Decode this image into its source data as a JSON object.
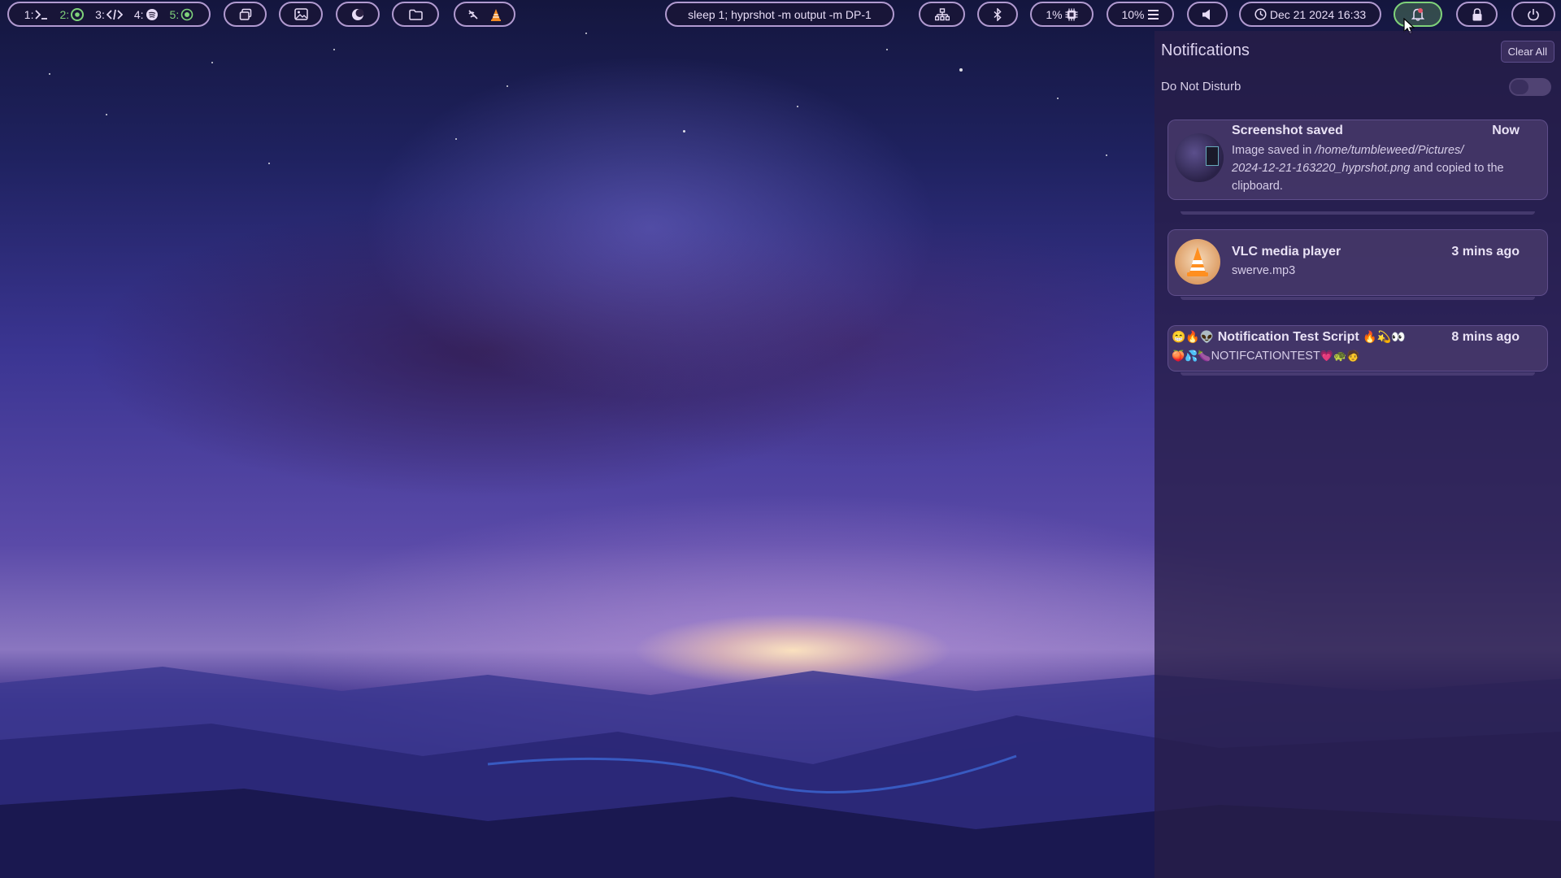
{
  "topbar": {
    "workspaces": [
      {
        "num": "1:",
        "icon": "terminal-icon",
        "active": false
      },
      {
        "num": "2:",
        "icon": "chrome-icon",
        "active": true
      },
      {
        "num": "3:",
        "icon": "code-icon",
        "active": false
      },
      {
        "num": "4:",
        "icon": "spotify-icon",
        "active": false
      },
      {
        "num": "5:",
        "icon": "record-icon",
        "active": true
      }
    ],
    "command": "sleep 1; hyprshot -m output -m DP-1",
    "cpu": "1%",
    "memory": "10%",
    "clock": "Dec 21 2024 16:33"
  },
  "notifications_panel": {
    "title": "Notifications",
    "clear_all": "Clear All",
    "dnd_label": "Do Not Disturb",
    "dnd_enabled": false,
    "items": [
      {
        "title": "Screenshot saved",
        "time": "Now",
        "body_prefix": "Image saved in ",
        "body_path_line1": "/home/tumbleweed/Pictures/",
        "body_path_line2": "2024-12-21-163220_hyprshot.png",
        "body_suffix": " and copied to the",
        "body_line3": "clipboard."
      },
      {
        "title": "VLC media player",
        "time": "3 mins ago",
        "body": "swerve.mp3"
      },
      {
        "title_prefix_emoji": "😁🔥👽",
        "title": "Notification Test Script",
        "title_suffix_emoji": "🔥💫👀",
        "time": "8 mins ago",
        "body_prefix_emoji": "🍑💦🍆",
        "body": "NOTIFCATIONTEST",
        "body_suffix_emoji": "💗🐢🧑"
      }
    ]
  },
  "colors": {
    "pill_border": "#b19ad0",
    "active_accent": "#7fd27a",
    "notif_dot": "#e5566a",
    "panel_bg": "#281e48"
  }
}
